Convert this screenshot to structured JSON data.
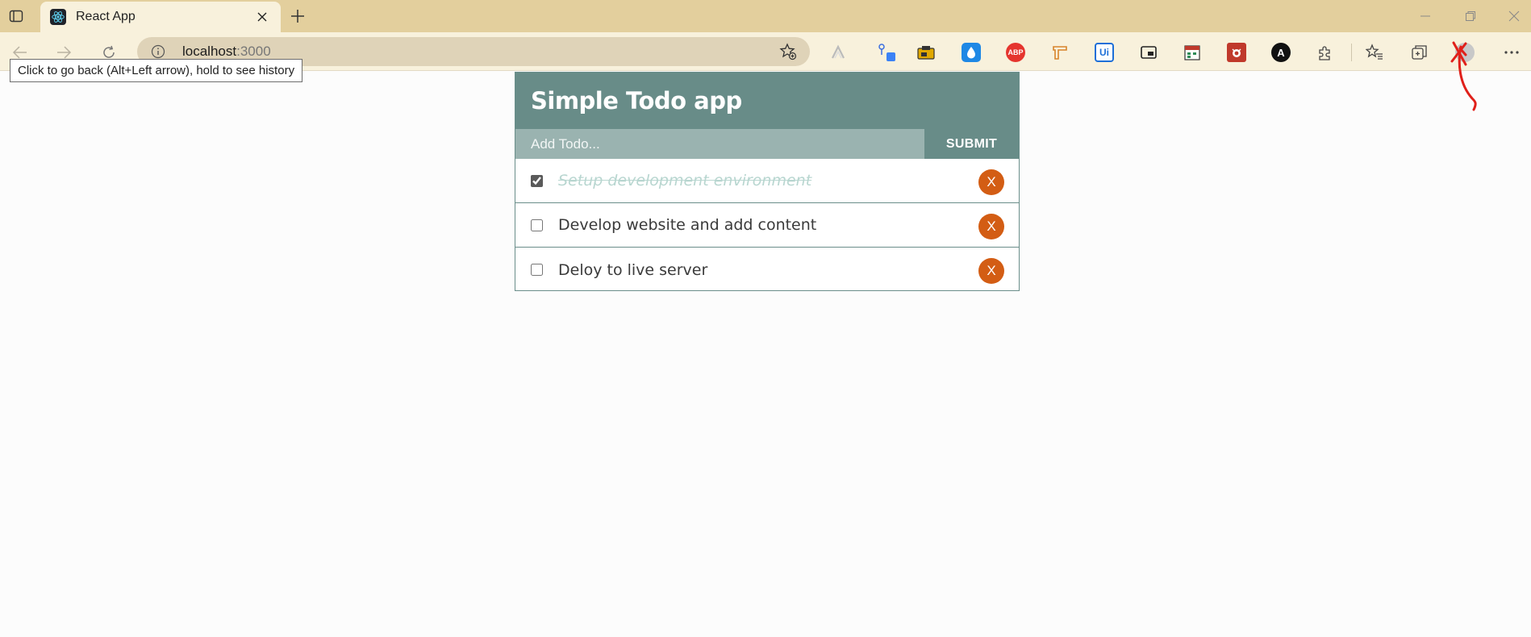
{
  "browser": {
    "tab": {
      "title": "React App",
      "favicon": "react-icon"
    },
    "address": {
      "host": "localhost",
      "port": ":3000"
    },
    "tooltip": "Click to go back (Alt+Left arrow), hold to see history",
    "extensions": [
      {
        "name": "sidebar-icon",
        "label": ""
      },
      {
        "name": "abp-extension-icon",
        "label": "ABP"
      },
      {
        "name": "ui-extension-icon",
        "label": "Ui"
      },
      {
        "name": "angular-extension-icon",
        "label": "A"
      }
    ]
  },
  "app": {
    "title": "Simple Todo app",
    "input_placeholder": "Add Todo...",
    "submit_label": "SUBMIT",
    "todos": [
      {
        "text": "Setup development environment",
        "done": true,
        "delete_label": "X"
      },
      {
        "text": "Develop website and add content",
        "done": false,
        "delete_label": "X"
      },
      {
        "text": "Deloy to live server",
        "done": false,
        "delete_label": "X"
      }
    ]
  },
  "colors": {
    "header": "#688c88",
    "input_bg": "#9ab3b0",
    "delete_button": "#d35d14",
    "done_text": "#b8d6d0",
    "tabbar": "#e3cf9d",
    "toolbar": "#f8f1dc"
  }
}
